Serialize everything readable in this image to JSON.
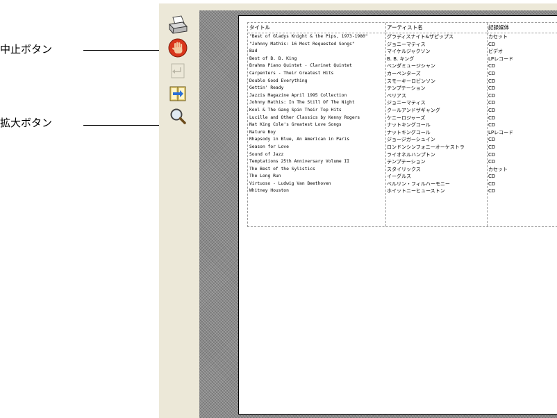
{
  "annotations": {
    "stop_button": "中止ボタン",
    "zoom_button": "拡大ボタン"
  },
  "toolbar": {
    "buttons": [
      {
        "name": "print",
        "icon": "printer-icon",
        "enabled": true
      },
      {
        "name": "stop",
        "icon": "stop-hand-icon",
        "enabled": true
      },
      {
        "name": "prev",
        "icon": "back-arrow-icon",
        "enabled": false
      },
      {
        "name": "next",
        "icon": "book-arrow-icon",
        "enabled": true
      },
      {
        "name": "zoom",
        "icon": "magnifier-icon",
        "enabled": true
      }
    ]
  },
  "table": {
    "headers": [
      "タイトル",
      "アーティスト名",
      "記録媒体"
    ],
    "rows": [
      [
        "\"Best of Gladys Knight & the Pips, 1973-1980\"",
        "グラディスナイト&ザピップス",
        "カセット"
      ],
      [
        "\"Johnny Mathis: 16 Most Requested Songs\"",
        "ジョニーマティス",
        "CD"
      ],
      [
        "Bad",
        "マイケルジャクソン",
        "ビデオ"
      ],
      [
        "Best of B. B. King",
        "B. B. キング",
        "LPレコード"
      ],
      [
        "Brahms Piano Quintet - Clarinet Quintet",
        "ベンダミュージシャン",
        "CD"
      ],
      [
        "Carpenters - Their Greatest Hits",
        "カーペンターズ",
        "CD"
      ],
      [
        "Double Good Everything",
        "スモーキーロビンソン",
        "CD"
      ],
      [
        "Gettin' Ready",
        "テンプテーション",
        "CD"
      ],
      [
        "Jazzis Magazine April 1995 Collection",
        "ベリアス",
        "CD"
      ],
      [
        "Johnny Mathis: In The Still Of The Night",
        "ジョニーマティス",
        "CD"
      ],
      [
        "Kool & The Gang Spin Their Top Hits",
        "クールアンドザギャング",
        "CD"
      ],
      [
        "Lucille and Other Classics by Kenny Rogers",
        "ケニーロジャーズ",
        "CD"
      ],
      [
        "Nat King Cole's Greatest Love Songs",
        "ナットキングコール",
        "CD"
      ],
      [
        "Nature Boy",
        "ナットキングコール",
        "LPレコード"
      ],
      [
        "Rhapsody in Blue, An American in Paris",
        "ジョージガーシュイン",
        "CD"
      ],
      [
        "Season for Love",
        "ロンドンシンフォニーオーケストラ",
        "CD"
      ],
      [
        "Sound of Jazz",
        "ライオネルハンプトン",
        "CD"
      ],
      [
        "Temptations 25th Anniversary Volume II",
        "テンプテーション",
        "CD"
      ],
      [
        "The Best of the Sylistics",
        "スタイリックス",
        "カセット"
      ],
      [
        "The Long Run",
        "イーグルス",
        "CD"
      ],
      [
        "Virtuoso - Ludwig Van Beethoven",
        "ベルリン・フィルハーモニー",
        "CD"
      ],
      [
        "Whitney Houston",
        "ホイットニーヒューストン",
        "CD"
      ]
    ]
  }
}
